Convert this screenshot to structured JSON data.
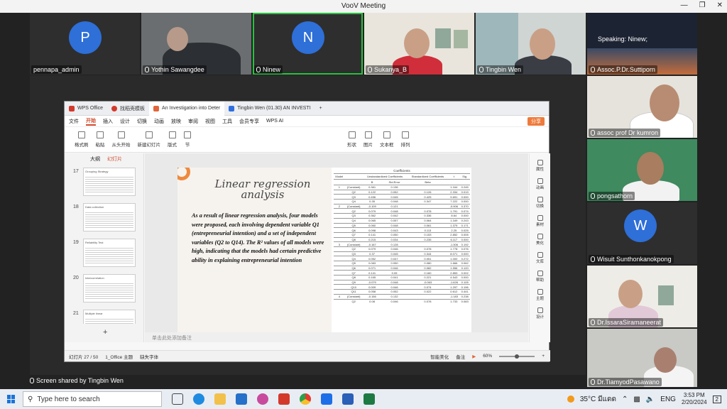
{
  "window": {
    "title": "VooV Meeting"
  },
  "participants_top": [
    {
      "name": "pennapa_admin",
      "initial": "P",
      "type": "avatar",
      "mic": false
    },
    {
      "name": "Yothin Sawangdee",
      "type": "video",
      "mic": true
    },
    {
      "name": "Ninew",
      "initial": "N",
      "type": "avatar",
      "mic": true,
      "speaking": true
    },
    {
      "name": "Sukanya_B",
      "type": "video",
      "mic": true
    },
    {
      "name": "Tingbin Wen",
      "type": "video",
      "mic": true
    }
  ],
  "participants_side": [
    {
      "name": "Assoc.P.Dr.Suttiporn",
      "type": "video"
    },
    {
      "name": "assoc prof Dr kumron",
      "type": "video"
    },
    {
      "name": "pongsathorn",
      "type": "video"
    },
    {
      "name": "Wisuit  Sunthonkanokpong",
      "initial": "W",
      "type": "avatar"
    },
    {
      "name": "Dr.IssaraSiramaneerat",
      "type": "video"
    },
    {
      "name": "Dr.TiamyodPasawano",
      "type": "video"
    }
  ],
  "speaking_label": "Speaking:  Ninew;",
  "screen_share": {
    "label": "Screen shared by Tingbin Wen"
  },
  "wps": {
    "tabs": [
      {
        "label": "WPS Office",
        "color": "#d3392b"
      },
      {
        "label": "找稻壳模板",
        "color": "#d3392b"
      },
      {
        "label": "An Investigation into Deter",
        "color": "#e0663a",
        "active": true
      },
      {
        "label": "Tingbin Wen (01.30)  AN INVESTI",
        "color": "#2f6ee0"
      }
    ],
    "menu": [
      "文件",
      "开始",
      "插入",
      "设计",
      "切换",
      "动画",
      "放映",
      "审阅",
      "视图",
      "工具",
      "会员专享",
      "WPS AI"
    ],
    "menu_active": "开始",
    "share_btn": "分享",
    "toolbar": [
      "格式刷",
      "粘贴",
      "从头开始",
      "新建幻灯片",
      "版式",
      "节",
      "形状",
      "图片",
      "文本框",
      "排列"
    ],
    "left_tabs": {
      "outline": "大纲",
      "slides": "幻灯片"
    },
    "thumbs": [
      {
        "num": "17",
        "title": "Grouping Strategy"
      },
      {
        "num": "18",
        "title": "Data collection"
      },
      {
        "num": "19",
        "title": "Reliability Test"
      },
      {
        "num": "20",
        "title": "Intercorrelation"
      },
      {
        "num": "21",
        "title": "Multiple linear"
      }
    ],
    "slide": {
      "title": "Linear regression analysis",
      "body": "As a result of linear regression analysis, four models were proposed, each involving dependent variable Q1 (entrepreneurial intention) and a set of independent variables (Q2 to Q14). The R² values of all models were high, indicating that the models had certain predictive ability in explaining entrepreneurial intention",
      "table_title": "Coefficients",
      "columns": [
        "Model",
        "",
        "B",
        "Std.Error",
        "Beta",
        "t",
        "Sig."
      ],
      "header_groups": {
        "unstd": "Unstandardized Coefficients",
        "std": "Standardized Coefficients"
      },
      "rows": [
        [
          "1",
          "(Constant)",
          "0.361",
          "0.136",
          "",
          "1.164",
          "0.245"
        ],
        [
          "",
          "Q2",
          "0.122",
          "0.052",
          "0.126",
          "2.334",
          "0.019"
        ],
        [
          "",
          "Q3",
          "0.456",
          "0.045",
          "0.425",
          "9.691",
          "0.000"
        ],
        [
          "",
          "Q4",
          "0.35",
          "0.048",
          "0.347",
          "7.222",
          "0.000"
        ],
        [
          "2",
          "(Constant)",
          "-0.109",
          "0.121",
          "",
          "-0.906",
          "0.370"
        ],
        [
          "",
          "Q2",
          "0.079",
          "0.048",
          "0.078",
          "1.791",
          "0.074"
        ],
        [
          "",
          "Q3",
          "0.362",
          "0.042",
          "0.336",
          "8.64",
          "0.000"
        ],
        [
          "",
          "Q4",
          "0.065",
          "0.057",
          "0.064",
          "1.169",
          "0.243"
        ],
        [
          "",
          "Q5",
          "0.060",
          "0.048",
          "0.061",
          "1.375",
          "0.171"
        ],
        [
          "",
          "Q6",
          "0.098",
          "0.043",
          "0.113",
          "2.25",
          "0.025"
        ],
        [
          "",
          "Q7",
          "0.141",
          "0.050",
          "0.153",
          "2.852",
          "0.005"
        ],
        [
          "",
          "Q8",
          "0.215",
          "0.034",
          "0.235",
          "6.117",
          "0.000"
        ],
        [
          "3",
          "(Constant)",
          "-0.167",
          "0.128",
          "",
          "-1.306",
          "0.192"
        ],
        [
          "",
          "Q2",
          "0.079",
          "0.046",
          "0.078",
          "1.778",
          "0.076"
        ],
        [
          "",
          "Q3",
          "0.37",
          "0.045",
          "0.344",
          "8.071",
          "0.000"
        ],
        [
          "",
          "Q4",
          "0.052",
          "0.047",
          "0.051",
          "1.000",
          "0.272"
        ],
        [
          "",
          "Q5",
          "0.083",
          "0.050",
          "0.080",
          "1.666",
          "0.062"
        ],
        [
          "",
          "Q6",
          "0.071",
          "0.046",
          "0.082",
          "1.556",
          "0.120"
        ],
        [
          "",
          "Q7",
          "0.141",
          "0.05",
          "0.160",
          "2.853",
          "0.002"
        ],
        [
          "",
          "Q8",
          "0.165",
          "0.041",
          "0.221",
          "4.543",
          "0.000"
        ],
        [
          "",
          "Q9",
          "-0.079",
          "0.048",
          "-0.063",
          "-1.626",
          "0.105"
        ],
        [
          "",
          "Q10",
          "0.009",
          "0.046",
          "0.074",
          "1.297",
          "0.196"
        ],
        [
          "",
          "Q11",
          "0.058",
          "0.052",
          "0.022",
          "0.612",
          "0.441"
        ],
        [
          "4",
          "(Constant)",
          "-0.156",
          "0.132",
          "",
          "-1.183",
          "0.238"
        ],
        [
          "",
          "Q2",
          "0.08",
          "0.046",
          "0.078",
          "1.733",
          "0.083"
        ]
      ]
    },
    "notes_placeholder": "单击此处添加备注",
    "right_panel": [
      "属性",
      "动画",
      "切换",
      "素材",
      "美化",
      "文库",
      "帮助",
      "主题",
      "设计"
    ],
    "status": {
      "slide_pos": "幻灯片 27 / 50",
      "theme": "1_Office 主题",
      "font_missing": "缺失字体",
      "smart": "智能美化",
      "notes": "备注",
      "zoom": "60%"
    }
  },
  "taskbar": {
    "search_placeholder": "Type here to search",
    "weather": "35°C  มีแดด",
    "lang": "ENG",
    "time": "3:53 PM",
    "date": "2/20/2024",
    "notif_count": "2"
  }
}
